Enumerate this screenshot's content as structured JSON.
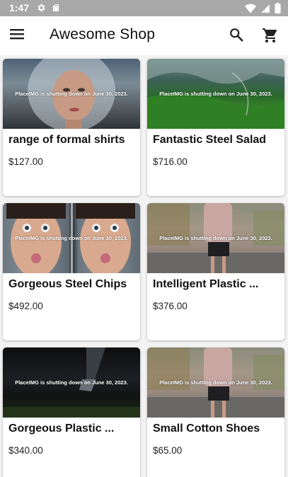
{
  "status": {
    "time": "1:47",
    "left_icons": [
      "settings-gear-icon",
      "sd-card-icon"
    ],
    "right_icons": [
      "wifi-icon",
      "signal-icon",
      "battery-icon"
    ]
  },
  "app_bar": {
    "title": "Awesome Shop",
    "menu_icon": "hamburger-menu-icon",
    "search_icon": "search-icon",
    "cart_icon": "shopping-cart-icon"
  },
  "products": [
    {
      "name": "range of formal shirts",
      "price": "$127.00",
      "image_caption": "PlaceIMG is shutting down on June 30, 2023."
    },
    {
      "name": "Fantastic Steel Salad",
      "price": "$716.00",
      "image_caption": "PlaceIMG is shutting down on June 30, 2023."
    },
    {
      "name": "Gorgeous Steel Chips",
      "price": "$492.00",
      "image_caption": "PlaceIMG is shutting down on June 30, 2023."
    },
    {
      "name": "Intelligent Plastic ...",
      "price": "$376.00",
      "image_caption": "PlaceIMG is shutting down on June 30, 2023."
    },
    {
      "name": "Gorgeous Plastic ...",
      "price": "$340.00",
      "image_caption": "PlaceIMG is shutting down on June 30, 2023."
    },
    {
      "name": "Small Cotton Shoes",
      "price": "$65.00",
      "image_caption": "PlaceIMG is shutting down on June 30, 2023."
    }
  ]
}
